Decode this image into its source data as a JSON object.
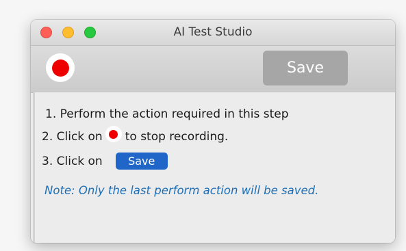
{
  "window": {
    "title": "AI Test Studio"
  },
  "toolbar": {
    "record_icon": "record-icon",
    "save_label": "Save"
  },
  "instructions": {
    "step1": "1. Perform the action required in this step",
    "step2_prefix": "2. Click on",
    "step2_suffix": "to stop recording.",
    "step3_prefix": "3. Click on",
    "step3_button": "Save",
    "note": "Note: Only the last perform action will be saved."
  },
  "colors": {
    "record": "#ee0000",
    "save_button_disabled": "#a6a6a6",
    "save_button_inline": "#1f66c8",
    "note_text": "#1f6fb5"
  }
}
